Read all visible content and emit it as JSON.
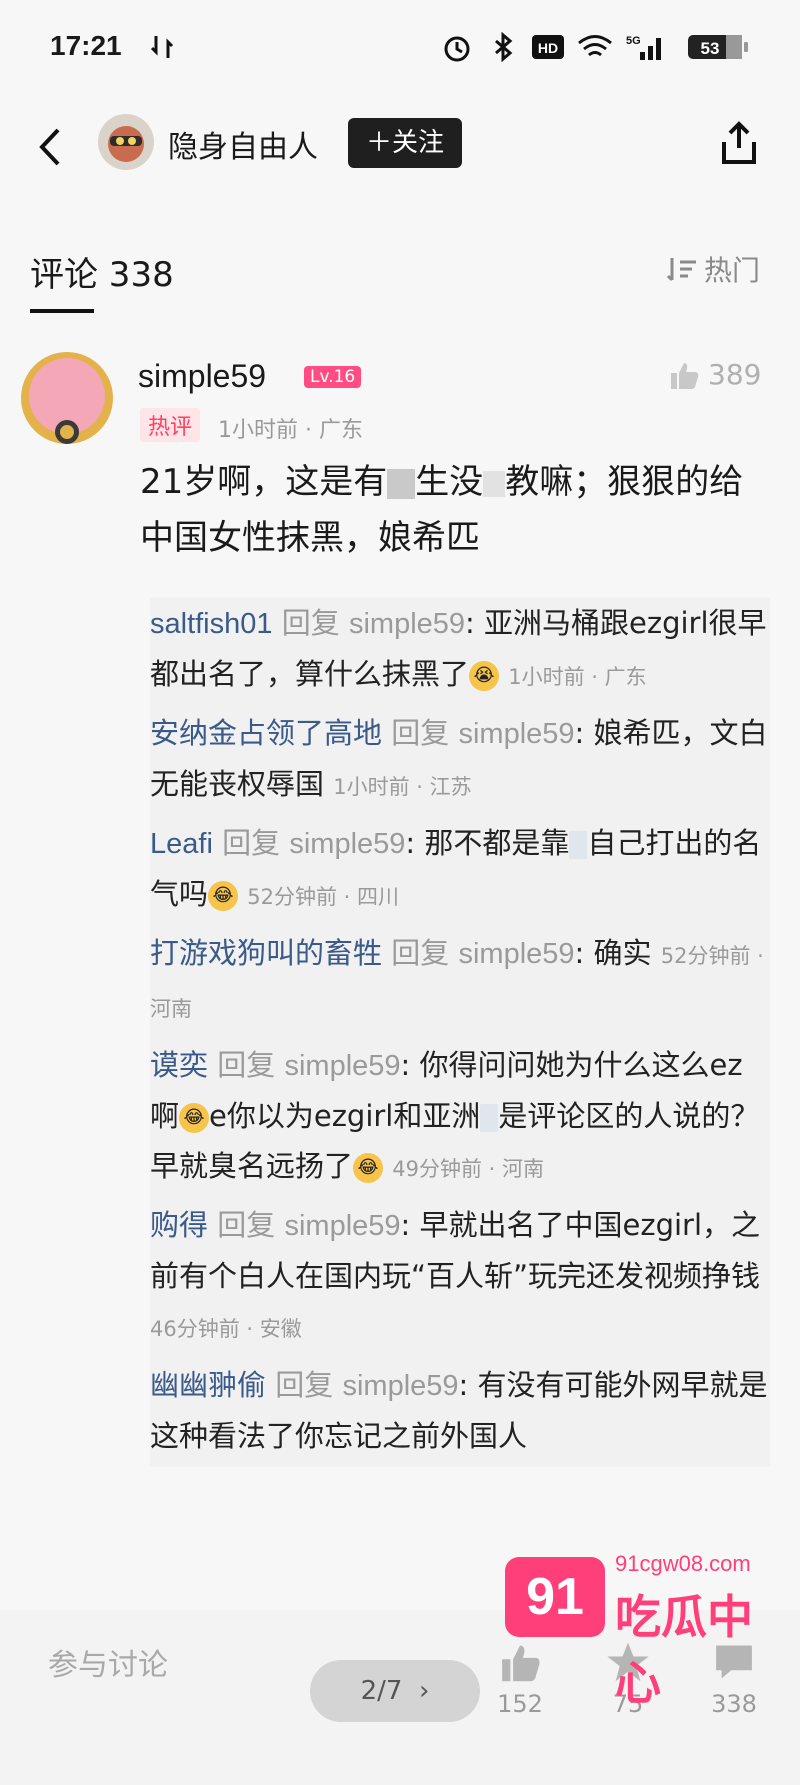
{
  "status_bar": {
    "time": "17:21",
    "battery": "53"
  },
  "nav": {
    "author_name": "隐身自由人",
    "follow_label": "＋关注"
  },
  "comments_header": {
    "title": "评论 338",
    "sort_label": "热门"
  },
  "main_comment": {
    "username": "simple59",
    "level": "Lv.16",
    "likes": "389",
    "hot_badge": "热评",
    "meta": "1小时前 · 广东",
    "body_part1": "21岁啊，这是有",
    "body_part2": "生没",
    "body_part3": "教嘛；狠狠的给中国女性抹黑，娘希匹"
  },
  "replies": [
    {
      "name": "saltfish01",
      "to": "simple59",
      "text": "亚洲马桶跟ezgirl很早都出名了，算什么抹黑了",
      "meta": "1小时前 · 广东"
    },
    {
      "name": "安纳金占领了高地",
      "to": "simple59",
      "text": "娘希匹，文白无能丧权辱国",
      "meta": "1小时前 · 江苏"
    },
    {
      "name": "Leafi",
      "to": "simple59",
      "text": "那不都是靠",
      "text2": "自己打出的名气吗",
      "meta": "52分钟前 · 四川"
    },
    {
      "name": "打游戏狗叫的畜牲",
      "to": "simple59",
      "text": "确实",
      "meta": "52分钟前 · 河南"
    },
    {
      "name": "谟奕",
      "to": "simple59",
      "text": "你得问问她为什么这么ez啊",
      "text2": "e你以为ezgirl和亚洲",
      "text3": "是评论区的人说的？早就臭名远扬了",
      "meta": "49分钟前 · 河南"
    },
    {
      "name": "购得",
      "to": "simple59",
      "text": "早就出名了中国ezgirl，之前有个白人在国内玩“百人斩”玩完还发视频挣钱",
      "meta": "46分钟前 · 安徽"
    },
    {
      "name": "幽幽翀偷",
      "to": "simple59",
      "text": "有没有可能外网早就是这种看法了你忘记之前外国人",
      "meta": ""
    }
  ],
  "reply_word": "回复",
  "bottom_bar": {
    "input_placeholder": "参与讨论",
    "page_indicator": "2/7",
    "like_count": "152",
    "star_count": "75",
    "comment_count": "338"
  },
  "watermark": {
    "url": "91cgw08.com",
    "logo": "91",
    "text": "吃瓜中心"
  },
  "colors": {
    "follow_bg": "#1f1f1f",
    "level_badge": "#ff4c82",
    "hot_badge_text": "#ff4060",
    "reply_name": "#3a5a8a",
    "watermark": "#ff3f7a"
  }
}
